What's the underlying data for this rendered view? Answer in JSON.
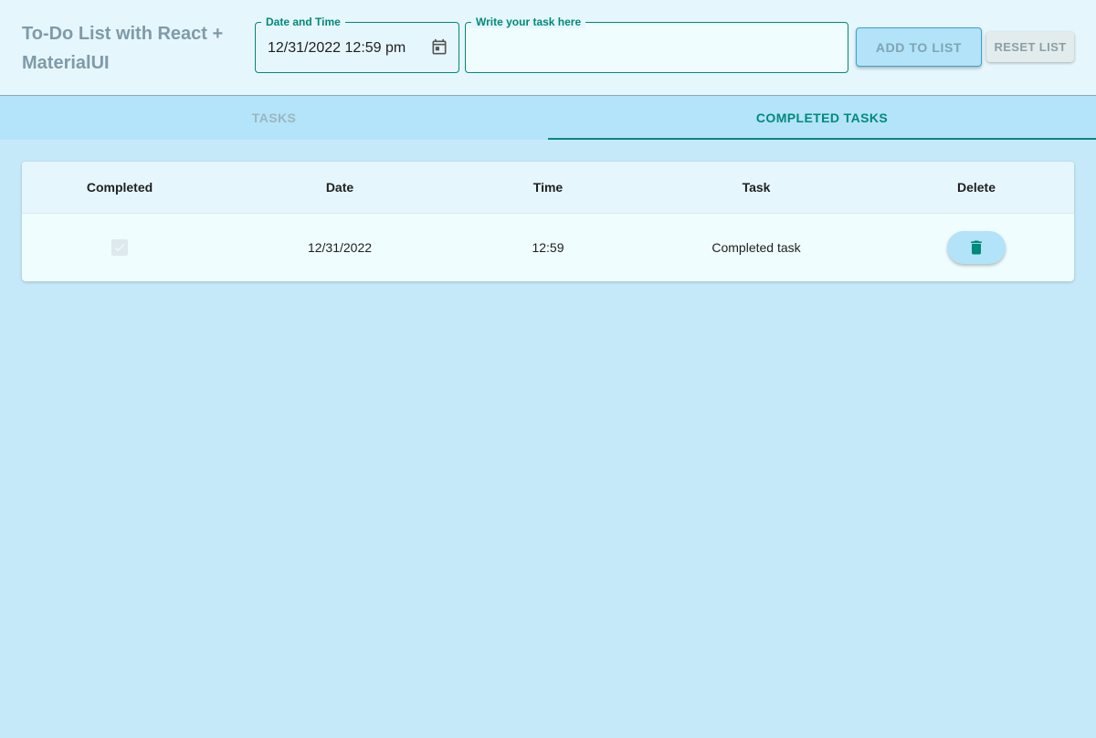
{
  "header": {
    "title": "To-Do List with React + MaterialUI",
    "date_field": {
      "label": "Date and Time",
      "value": "12/31/2022 12:59 pm",
      "icon": "calendar-icon"
    },
    "task_field": {
      "label": "Write your task here",
      "value": "",
      "placeholder": ""
    },
    "add_button": "ADD TO LIST",
    "reset_button": "RESET LIST"
  },
  "tabs": {
    "items": [
      {
        "label": "TASKS",
        "selected": false
      },
      {
        "label": "COMPLETED TASKS",
        "selected": true
      }
    ]
  },
  "table": {
    "columns": [
      "Completed",
      "Date",
      "Time",
      "Task",
      "Delete"
    ],
    "rows": [
      {
        "completed": true,
        "date": "12/31/2022",
        "time": "12:59",
        "task": "Completed task",
        "delete_icon": "trash-icon"
      }
    ]
  },
  "colors": {
    "accent": "#00897b",
    "background": "#c6e9fa",
    "appbar": "#e6f6fd",
    "tabbar": "#b3e4f9"
  }
}
